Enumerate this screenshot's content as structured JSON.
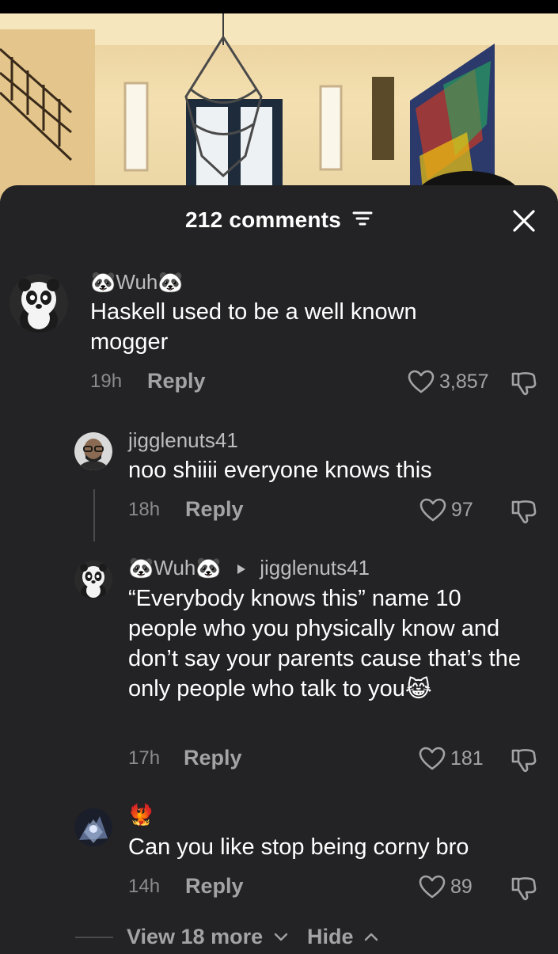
{
  "header": {
    "comments_count_label": "212 comments"
  },
  "comments": [
    {
      "username": "🐼Wuh🐼",
      "text": "Haskell used to be a well known mogger",
      "time": "19h",
      "reply_label": "Reply",
      "likes": "3,857"
    },
    {
      "username": "jigglenuts41",
      "text": "noo shiiii everyone knows this",
      "time": "18h",
      "reply_label": "Reply",
      "likes": "97"
    },
    {
      "username": "🐼Wuh🐼",
      "reply_to": "jigglenuts41",
      "text_prefix": "“Everybody knows this” name 10 people who you physically know and don’t say your parents cause that’s the only people who talk to you",
      "text_emoji": "😹",
      "time": "17h",
      "reply_label": "Reply",
      "likes": "181"
    },
    {
      "username": "🐦‍🔥",
      "text": "Can you like stop being corny bro",
      "time": "14h",
      "reply_label": "Reply",
      "likes": "89"
    }
  ],
  "footer": {
    "view_more_label": "View 18 more",
    "hide_label": "Hide"
  },
  "colors": {
    "sheet_bg": "#232325",
    "text_primary": "#ffffff",
    "text_secondary": "#a3a3a6"
  }
}
